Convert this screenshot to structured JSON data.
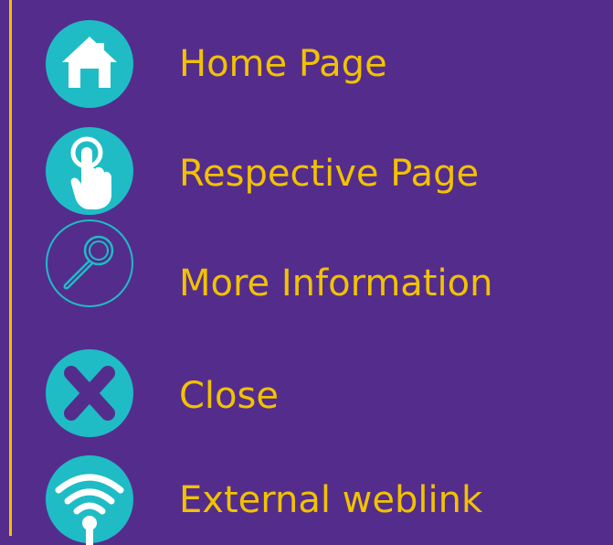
{
  "theme": {
    "background": "#542d8c",
    "icon_color": "#1fbcc6",
    "text_color": "#f2c200",
    "border_color": "#f2c200"
  },
  "legend": {
    "items": [
      {
        "icon": "home-icon",
        "label": "Home Page"
      },
      {
        "icon": "touch-hand-icon",
        "label": "Respective Page"
      },
      {
        "icon": "magnifier-icon",
        "label": "More Information"
      },
      {
        "icon": "close-icon",
        "label": "Close"
      },
      {
        "icon": "wifi-icon",
        "label": "External weblink"
      }
    ]
  }
}
